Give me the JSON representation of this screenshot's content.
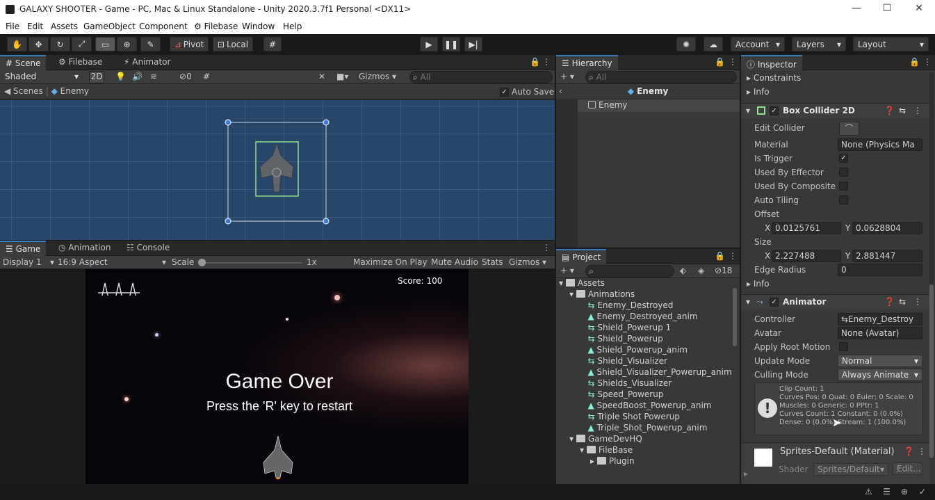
{
  "window": {
    "title": "GALAXY SHOOTER - Game - PC, Mac & Linux Standalone - Unity 2020.3.7f1 Personal <DX11>"
  },
  "menu": [
    "File",
    "Edit",
    "Assets",
    "GameObject",
    "Component",
    "Filebase",
    "Window",
    "Help"
  ],
  "toolbar": {
    "pivot": "Pivot",
    "local": "Local",
    "account": "Account",
    "layers": "Layers",
    "layout": "Layout"
  },
  "scene": {
    "tabs": [
      "Scene",
      "Filebase",
      "Animator"
    ],
    "shading": "Shaded",
    "mode2d": "2D",
    "hidden_count": "0",
    "gizmos": "Gizmos",
    "search_placeholder": "All",
    "breadcrumb_root": "Scenes",
    "breadcrumb_item": "Enemy",
    "auto_save": "Auto Save"
  },
  "game": {
    "tabs": [
      "Game",
      "Animation",
      "Console"
    ],
    "display": "Display 1",
    "aspect": "16:9 Aspect",
    "scale_label": "Scale",
    "scale_value": "1x",
    "maximize": "Maximize On Play",
    "mute": "Mute Audio",
    "stats": "Stats",
    "gizmos": "Gizmos",
    "score": "Score: 100",
    "game_over": "Game Over",
    "restart": "Press the 'R' key to restart"
  },
  "hierarchy": {
    "tab": "Hierarchy",
    "search_placeholder": "All",
    "prefab": "Enemy",
    "items": [
      "Enemy"
    ]
  },
  "project": {
    "tab": "Project",
    "hidden_count": "18",
    "tree": [
      {
        "label": "Assets",
        "level": 0,
        "kind": "folder"
      },
      {
        "label": "Animations",
        "level": 1,
        "kind": "folder"
      },
      {
        "label": "Enemy_Destroyed",
        "level": 2,
        "kind": "controller"
      },
      {
        "label": "Enemy_Destroyed_anim",
        "level": 2,
        "kind": "clip"
      },
      {
        "label": "Shield_Powerup 1",
        "level": 2,
        "kind": "controller"
      },
      {
        "label": "Shield_Powerup",
        "level": 2,
        "kind": "controller"
      },
      {
        "label": "Shield_Powerup_anim",
        "level": 2,
        "kind": "clip"
      },
      {
        "label": "Shield_Visualizer",
        "level": 2,
        "kind": "controller"
      },
      {
        "label": "Shield_Visualizer_Powerup_anim",
        "level": 2,
        "kind": "clip"
      },
      {
        "label": "Shields_Visualizer",
        "level": 2,
        "kind": "controller"
      },
      {
        "label": "Speed_Powerup",
        "level": 2,
        "kind": "controller"
      },
      {
        "label": "SpeedBoost_Powerup_anim",
        "level": 2,
        "kind": "clip"
      },
      {
        "label": "Triple Shot Powerup",
        "level": 2,
        "kind": "controller"
      },
      {
        "label": "Triple_Shot_Powerup_anim",
        "level": 2,
        "kind": "clip"
      },
      {
        "label": "GameDevHQ",
        "level": 1,
        "kind": "folder"
      },
      {
        "label": "FileBase",
        "level": 2,
        "kind": "folder"
      },
      {
        "label": "Plugin",
        "level": 3,
        "kind": "folder"
      }
    ]
  },
  "inspector": {
    "tab": "Inspector",
    "constraints": "Constraints",
    "info1": "Info",
    "box": {
      "title": "Box Collider 2D",
      "edit_collider": "Edit Collider",
      "material": "Material",
      "material_value": "None (Physics Ma",
      "is_trigger": "Is Trigger",
      "used_effector": "Used By Effector",
      "used_composite": "Used By Composite",
      "auto_tiling": "Auto Tiling",
      "offset": "Offset",
      "offset_x": "0.0125761",
      "offset_y": "0.0628804",
      "size": "Size",
      "size_x": "2.227488",
      "size_y": "2.881447",
      "edge_radius": "Edge Radius",
      "edge_radius_value": "0",
      "info": "Info",
      "x": "X",
      "y": "Y"
    },
    "animator": {
      "title": "Animator",
      "controller": "Controller",
      "controller_value": "Enemy_Destroy",
      "avatar": "Avatar",
      "avatar_value": "None (Avatar)",
      "apply_root": "Apply Root Motion",
      "update_mode": "Update Mode",
      "update_mode_value": "Normal",
      "culling_mode": "Culling Mode",
      "culling_mode_value": "Always Animate",
      "info_lines": [
        "Clip Count: 1",
        "Curves Pos: 0 Quat: 0 Euler: 0 Scale: 0",
        "Muscles: 0 Generic: 0 PPtr: 1",
        "Curves Count: 1 Constant: 0 (0.0%)",
        "Dense: 0 (0.0%) Stream: 1 (100.0%)"
      ]
    },
    "material": {
      "title": "Sprites-Default (Material)",
      "shader_label": "Shader",
      "shader_value": "Sprites/Default",
      "edit": "Edit..."
    }
  },
  "colors": {
    "accent": "#3a79bb",
    "scene_bg": "#27466a",
    "panel": "#383838"
  }
}
